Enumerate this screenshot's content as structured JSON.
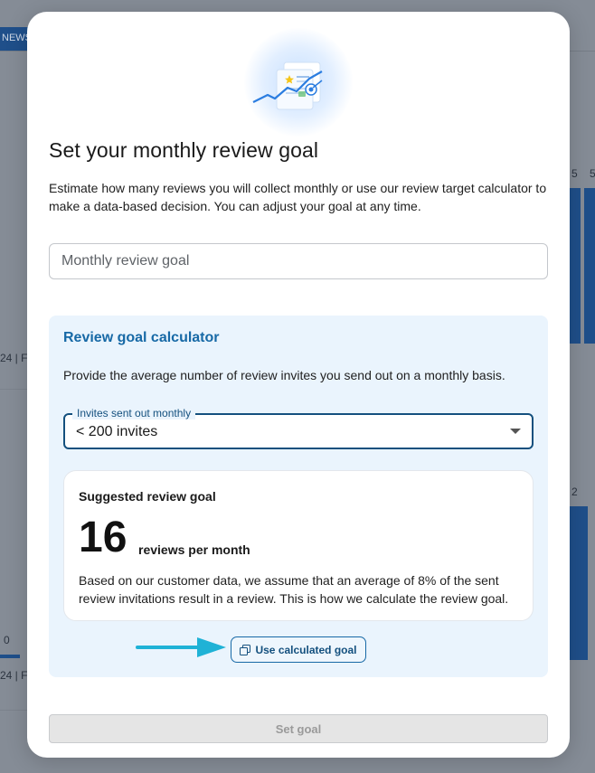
{
  "background": {
    "tab_fragment": "NEWS",
    "left_label_1": "24 | F",
    "left_label_2": "24 | F",
    "left_zero": "0",
    "right_5": "5",
    "right_5b": "5",
    "right_2": "2"
  },
  "modal": {
    "title": "Set your monthly review goal",
    "description": "Estimate how many reviews you will collect monthly or use our review target calculator to make a data-based decision. You can adjust your goal at any time.",
    "goal_input": {
      "placeholder": "Monthly review goal",
      "value": ""
    },
    "calculator": {
      "title": "Review goal calculator",
      "description": "Provide the average number of review invites you send out on a monthly basis.",
      "select": {
        "label": "Invites sent out monthly",
        "value": "< 200 invites"
      },
      "suggestion": {
        "title": "Suggested review goal",
        "number": "16",
        "unit": "reviews per month",
        "description": "Based on our customer data, we assume that an average of 8% of the sent review invitations result in a review. This is how we calculate the review goal."
      },
      "use_button": {
        "label": "Use calculated goal",
        "icon": "copy-icon"
      }
    },
    "submit_button": {
      "label": "Set goal",
      "disabled": true
    }
  },
  "colors": {
    "accent": "#1769a6",
    "accent_dark": "#14507e",
    "calculator_bg": "#eaf4fd",
    "arrow": "#1fb2d6"
  }
}
